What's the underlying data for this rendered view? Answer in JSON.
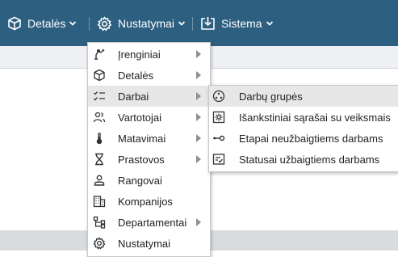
{
  "topbar": {
    "items": [
      {
        "label": "Detalės",
        "icon": "cube-icon"
      },
      {
        "label": "Nustatymai",
        "icon": "gear-icon"
      },
      {
        "label": "Sistema",
        "icon": "import-icon"
      }
    ]
  },
  "menu": {
    "items": [
      {
        "label": "Įrenginiai",
        "icon": "machine-icon",
        "has_submenu": true
      },
      {
        "label": "Detalės",
        "icon": "cube-icon",
        "has_submenu": true
      },
      {
        "label": "Darbai",
        "icon": "checklist-icon",
        "has_submenu": true,
        "active": true
      },
      {
        "label": "Vartotojai",
        "icon": "users-icon",
        "has_submenu": true
      },
      {
        "label": "Matavimai",
        "icon": "thermometer-icon",
        "has_submenu": true
      },
      {
        "label": "Prastovos",
        "icon": "hourglass-icon",
        "has_submenu": true
      },
      {
        "label": "Rangovai",
        "icon": "person-icon",
        "has_submenu": false
      },
      {
        "label": "Kompanijos",
        "icon": "building-icon",
        "has_submenu": false
      },
      {
        "label": "Departamentai",
        "icon": "org-chart-icon",
        "has_submenu": true
      },
      {
        "label": "Nustatymai",
        "icon": "gear-icon",
        "has_submenu": false
      }
    ]
  },
  "submenu": {
    "items": [
      {
        "label": "Darbų grupės",
        "icon": "group-icon",
        "active": true
      },
      {
        "label": "Išankstiniai sąrašai su veiksmais",
        "icon": "gear-box-icon"
      },
      {
        "label": "Etapai neužbaigtiems darbams",
        "icon": "key-icon"
      },
      {
        "label": "Statusai užbaigtiems darbams",
        "icon": "checklist-box-icon"
      }
    ]
  },
  "colors": {
    "topbar": "#2d5f80",
    "menu_active": "#e7e7e7",
    "page_strip": "#eef0f3",
    "footer_strip": "#d9dcdf"
  }
}
